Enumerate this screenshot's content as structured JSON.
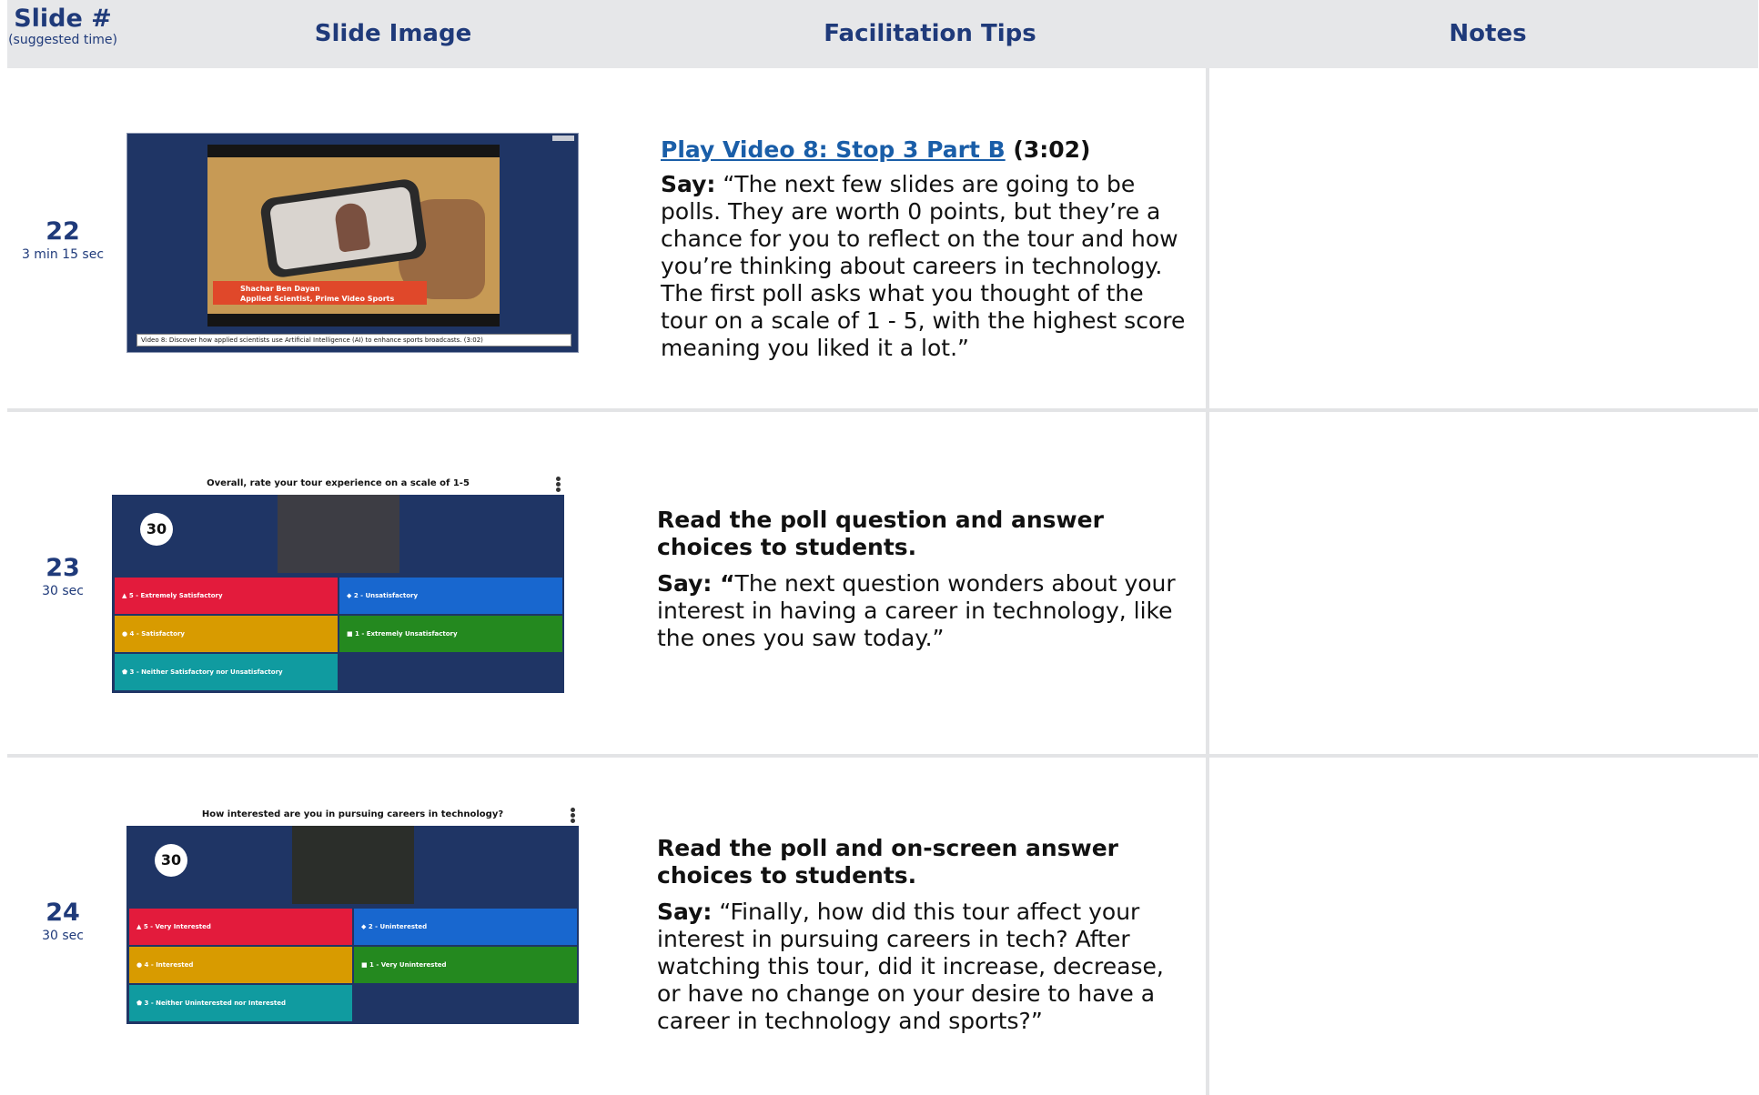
{
  "header": {
    "slide_label": "Slide #",
    "slide_sub": "(suggested time)",
    "image_label": "Slide Image",
    "tips_label": "Facilitation Tips",
    "notes_label": "Notes"
  },
  "rows": [
    {
      "slide": "22",
      "time": "3 min 15 sec",
      "tips_link": "Play Video 8: Stop 3 Part B",
      "tips_link_suffix": "(3:02)",
      "say_label": "Say:",
      "say_text": "“The next few slides are going to be polls. They are worth 0 points, but they’re a chance for you to reflect on the tour and how you’re thinking about careers in technology. The first poll asks what you thought of the tour on a scale of 1 - 5, with the highest score meaning you liked it a lot.”",
      "thumb": {
        "name_line1": "Shachar Ben Dayan",
        "name_line2": "Applied Scientist, Prime Video Sports",
        "caption": "Video 8: Discover how applied scientists use Artificial Intelligence (AI) to enhance sports broadcasts. (3:02)"
      }
    },
    {
      "slide": "23",
      "time": "30 sec",
      "tips_title": "Read the poll question and answer choices to students.",
      "say_label": "Say: “",
      "say_text": "The next question wonders about your interest in having a career in technology, like the ones you saw today.”",
      "poll": {
        "question": "Overall, rate your tour experience on a scale of 1-5",
        "timer": "30",
        "options": [
          "▲ 5 - Extremely Satisfactory",
          "◆ 2 - Unsatisfactory",
          "● 4 - Satisfactory",
          "■ 1 - Extremely Unsatisfactory",
          "⬟ 3 - Neither Satisfactory nor Unsatisfactory"
        ]
      }
    },
    {
      "slide": "24",
      "time": "30 sec",
      "tips_title": "Read the poll and on-screen answer choices to students.",
      "say_label": "Say:",
      "say_text": "“Finally, how did this tour affect your interest in pursuing careers in tech? After watching this tour, did it increase, decrease, or have no change on your desire to have a career in technology and sports?”",
      "poll": {
        "question": "How interested are you in pursuing careers in technology?",
        "timer": "30",
        "options": [
          "▲ 5 - Very Interested",
          "◆ 2 - Uninterested",
          "● 4 - Interested",
          "■ 1 - Very Uninterested",
          "⬟ 3 - Neither Uninterested nor Interested"
        ]
      }
    }
  ],
  "colors": {
    "heading": "#1f3a7a",
    "link": "#1a5ea8",
    "slide_bg": "#1f3565"
  }
}
